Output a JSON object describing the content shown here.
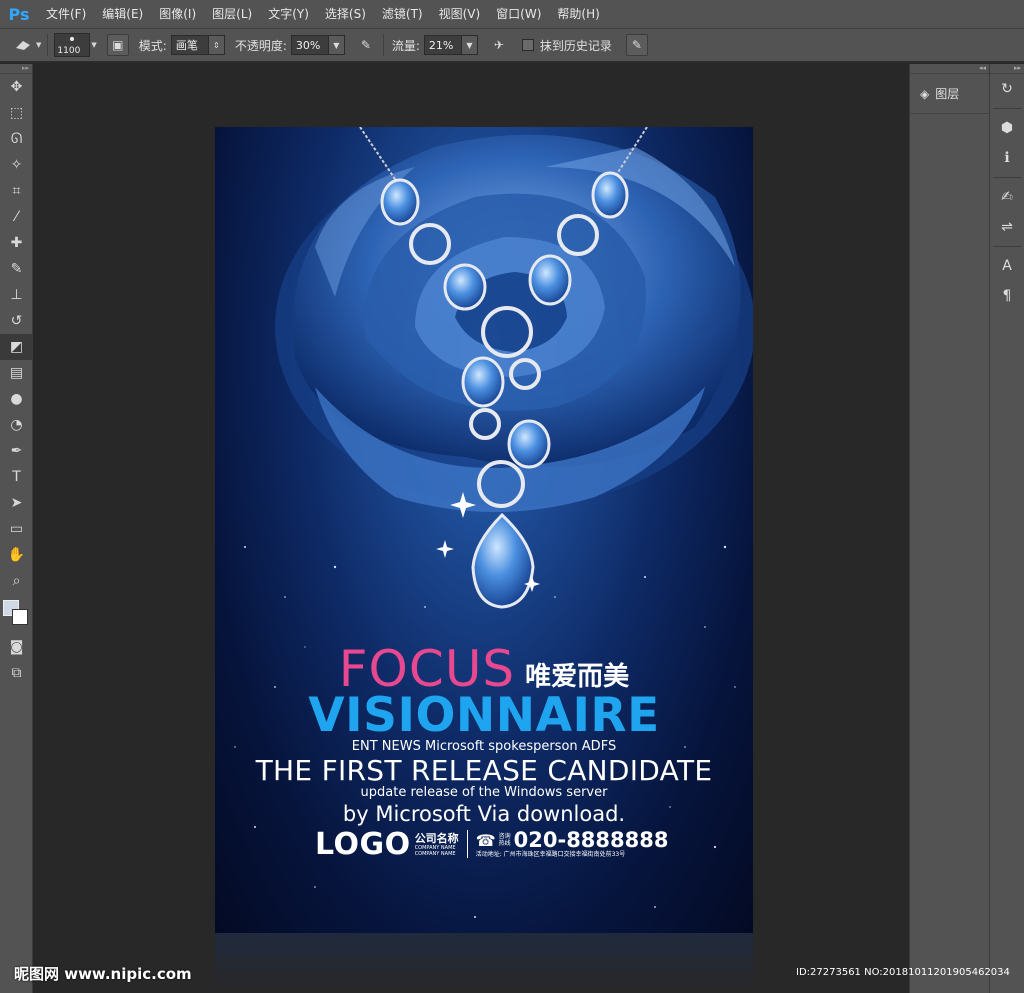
{
  "app": {
    "logo": "Ps"
  },
  "menu": [
    "文件(F)",
    "编辑(E)",
    "图像(I)",
    "图层(L)",
    "文字(Y)",
    "选择(S)",
    "滤镜(T)",
    "视图(V)",
    "窗口(W)",
    "帮助(H)"
  ],
  "options": {
    "brush_size": "1100",
    "mode_label": "模式:",
    "mode_value": "画笔",
    "opacity_label": "不透明度:",
    "opacity_value": "30%",
    "flow_label": "流量:",
    "flow_value": "21%",
    "history_label": "抹到历史记录"
  },
  "tools": [
    "move-tool-icon",
    "marquee-tool-icon",
    "lasso-tool-icon",
    "magic-wand-icon",
    "crop-tool-icon",
    "eyedropper-icon",
    "healing-brush-icon",
    "brush-tool-icon",
    "clone-stamp-icon",
    "history-brush-icon",
    "eraser-tool-icon",
    "gradient-tool-icon",
    "blur-tool-icon",
    "dodge-tool-icon",
    "pen-tool-icon",
    "type-tool-icon",
    "path-select-icon",
    "shape-tool-icon",
    "hand-tool-icon",
    "zoom-tool-icon"
  ],
  "panels": {
    "layers_label": "图层"
  },
  "poster": {
    "focus": "FOCUS",
    "focus_cn": "唯爱而美",
    "visionnaire": "VISIONNAIRE",
    "ent_news": "ENT NEWS Microsoft spokesperson ADFS",
    "first_release": "THE FIRST RELEASE CANDIDATE",
    "update_release": "update release of the Windows server",
    "by_ms": "by Microsoft Via download.",
    "logo": "LOGO",
    "company_cn": "公司名称",
    "company_en": "COMPANY NAME",
    "hotline_1": "咨询",
    "hotline_2": "热线",
    "phone": "020-8888888",
    "address": "活动地址: 广州市海珠区幸福路口交接幸福街南处前33号"
  },
  "watermark": {
    "left": "昵图网 www.nipic.com",
    "right": "ID:27273561 NO:20181011201905462034"
  },
  "colors": {
    "focus": "#e8488f",
    "visionnaire": "#1fa4f0",
    "ui_panel": "#535353"
  }
}
